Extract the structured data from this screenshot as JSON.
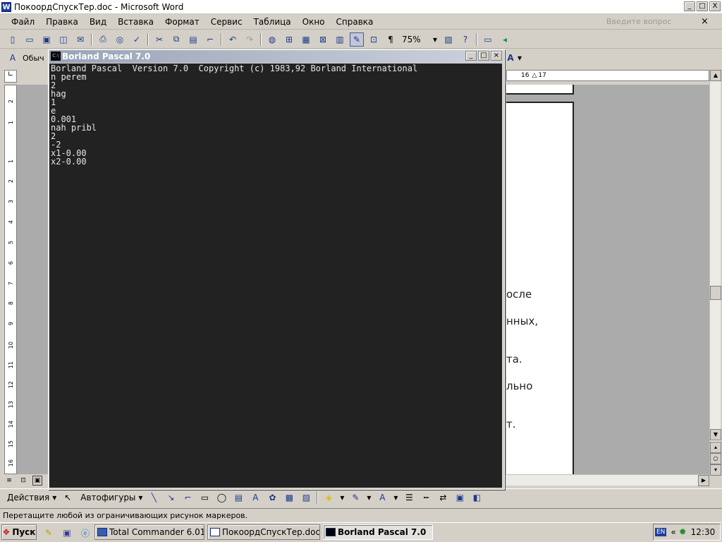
{
  "word": {
    "title": "ПокоордСпускТер.doc - Microsoft Word",
    "icon_letter": "W",
    "window_buttons": [
      "_",
      "□",
      "X"
    ],
    "menus": [
      "Файл",
      "Правка",
      "Вид",
      "Вставка",
      "Формат",
      "Сервис",
      "Таблица",
      "Окно",
      "Справка"
    ],
    "question_placeholder": "Введите вопрос",
    "close_doc": "×",
    "zoom": "75%",
    "style_box": "Обыч",
    "ruler_marks": [
      "16",
      "17"
    ],
    "vruler_marks": [
      "2",
      "1",
      "1",
      "2",
      "3",
      "4",
      "5",
      "6",
      "7",
      "8",
      "9",
      "10",
      "11",
      "12",
      "13",
      "14",
      "15",
      "16"
    ],
    "doc_fragments": [
      "осле",
      "нных,",
      "та.",
      "льно",
      "т."
    ],
    "draw_menu": "Действия",
    "autoshapes": "Автофигуры",
    "status_text": "Перетащите любой из ограничивающих рисунок маркеров."
  },
  "borland": {
    "title": "Borland Pascal 7.0",
    "icon_text": "C:\\",
    "console_lines": [
      "Borland Pascal  Version 7.0  Copyright (c) 1983,92 Borland International",
      "n perem",
      "2",
      "hag",
      "1",
      "e",
      "0.001",
      "nah pribl",
      "2",
      "-2",
      "x1-0.00",
      "x2-0.00"
    ]
  },
  "taskbar": {
    "start": "Пуск",
    "tasks": [
      {
        "label": "Total Commander 6.01 - ..."
      },
      {
        "label": "ПокоордСпускТер.doc -..."
      },
      {
        "label": "Borland Pascal 7.0"
      }
    ],
    "lang": "EN",
    "time": "12:30"
  }
}
